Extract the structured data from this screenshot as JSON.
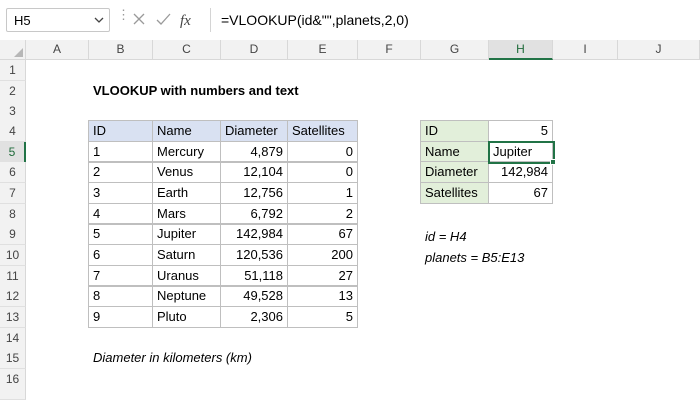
{
  "name_box": "H5",
  "formula": "=VLOOKUP(id&\"\",planets,2,0)",
  "fx_label": "fx",
  "columns": [
    "A",
    "B",
    "C",
    "D",
    "E",
    "F",
    "G",
    "H",
    "I",
    "J"
  ],
  "rows": [
    "1",
    "2",
    "3",
    "4",
    "5",
    "6",
    "7",
    "8",
    "9",
    "10",
    "11",
    "12",
    "13",
    "14",
    "15",
    "16"
  ],
  "title": "VLOOKUP with numbers and text",
  "table": {
    "headers": [
      "ID",
      "Name",
      "Diameter",
      "Satellites"
    ],
    "rows": [
      [
        "1",
        "Mercury",
        "4,879",
        "0"
      ],
      [
        "2",
        "Venus",
        "12,104",
        "0"
      ],
      [
        "3",
        "Earth",
        "12,756",
        "1"
      ],
      [
        "4",
        "Mars",
        "6,792",
        "2"
      ],
      [
        "5",
        "Jupiter",
        "142,984",
        "67"
      ],
      [
        "6",
        "Saturn",
        "120,536",
        "200"
      ],
      [
        "7",
        "Uranus",
        "51,118",
        "27"
      ],
      [
        "8",
        "Neptune",
        "49,528",
        "13"
      ],
      [
        "9",
        "Pluto",
        "2,306",
        "5"
      ]
    ]
  },
  "lookup": {
    "id_label": "ID",
    "id_value": "5",
    "name_label": "Name",
    "name_value": "Jupiter",
    "diameter_label": "Diameter",
    "diameter_value": "142,984",
    "satellites_label": "Satellites",
    "satellites_value": "67"
  },
  "notes": {
    "id_def": "id = H4",
    "planets_def": "planets = B5:E13",
    "footnote": "Diameter in kilometers (km)"
  },
  "colors": {
    "accent": "#217346",
    "table_header": "#d9e1f2",
    "lookup_label": "#e2efda"
  }
}
